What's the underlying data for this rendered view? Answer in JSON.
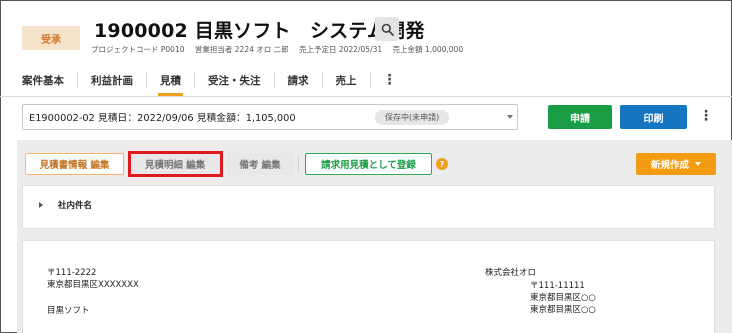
{
  "header": {
    "status_badge": "受承",
    "title": "1900002 目黒ソフト　システム開発",
    "meta": {
      "project_code": "プロジェクトコード P0010",
      "sales_rep": "営業担当者 2224 オロ 二郎",
      "sales_date": "売上予定日 2022/05/31",
      "sales_amount": "売上金額 1,000,000"
    }
  },
  "tabs": [
    "案件基本",
    "利益計画",
    "見積",
    "受注・失注",
    "請求",
    "売上"
  ],
  "active_tab": "見積",
  "tabs_more": "⋮",
  "estimate_select": {
    "value": "E1900002-02 見積日：2022/09/06 見積金額：1,105,000",
    "badge": "保存中(未申請)"
  },
  "actions": {
    "apply": "申請",
    "print": "印刷",
    "more": "⋮"
  },
  "subnav": {
    "info_edit": "見積書情報 編集",
    "detail_edit": "見積明細 編集",
    "note_edit": "備考 編集",
    "register": "請求用見積として登録",
    "help": "?",
    "new": "新規作成"
  },
  "internal_panel": {
    "label": "社内件名"
  },
  "document": {
    "client_postal": "〒111-2222",
    "client_address": "東京都目黒区XXXXXXX",
    "client_name": "目黒ソフト",
    "company_name": "株式会社オロ",
    "company_postal": "〒111-11111",
    "company_address_1": "東京都目黒区○○",
    "company_address_2": "東京都目黒区○○"
  },
  "colors": {
    "accent_orange": "#f0a020",
    "apply_green": "#1a9e45",
    "print_blue": "#1575c0",
    "highlight_red": "#e0191f"
  }
}
